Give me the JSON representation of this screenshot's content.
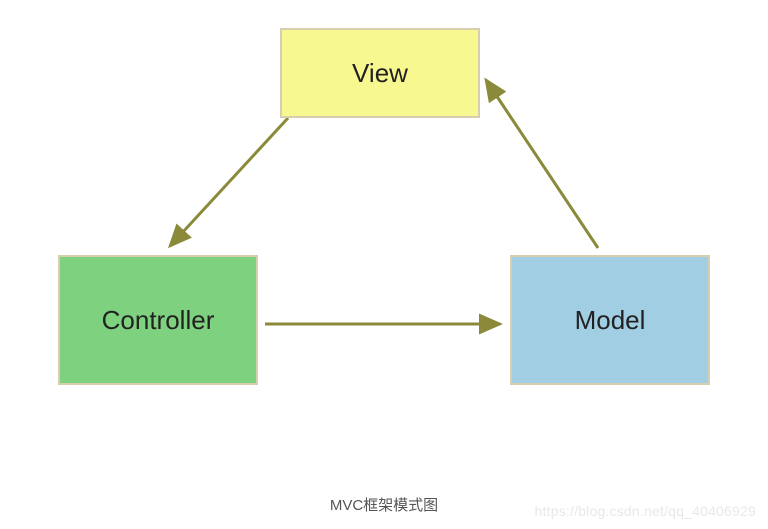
{
  "nodes": {
    "view": {
      "label": "View"
    },
    "controller": {
      "label": "Controller"
    },
    "model": {
      "label": "Model"
    }
  },
  "caption": "MVC框架模式图",
  "watermark": "https://blog.csdn.net/qq_40406929",
  "colors": {
    "view_fill": "#f8f891",
    "controller_fill": "#7ed17e",
    "model_fill": "#a2cee4",
    "box_border": "#d8cdae",
    "arrow": "#8a8a3a"
  },
  "chart_data": {
    "type": "diagram",
    "title": "MVC框架模式图",
    "nodes": [
      {
        "id": "View",
        "fill": "#f8f891"
      },
      {
        "id": "Controller",
        "fill": "#7ed17e"
      },
      {
        "id": "Model",
        "fill": "#a2cee4"
      }
    ],
    "edges": [
      {
        "from": "View",
        "to": "Controller"
      },
      {
        "from": "Controller",
        "to": "Model"
      },
      {
        "from": "Model",
        "to": "View"
      }
    ]
  }
}
